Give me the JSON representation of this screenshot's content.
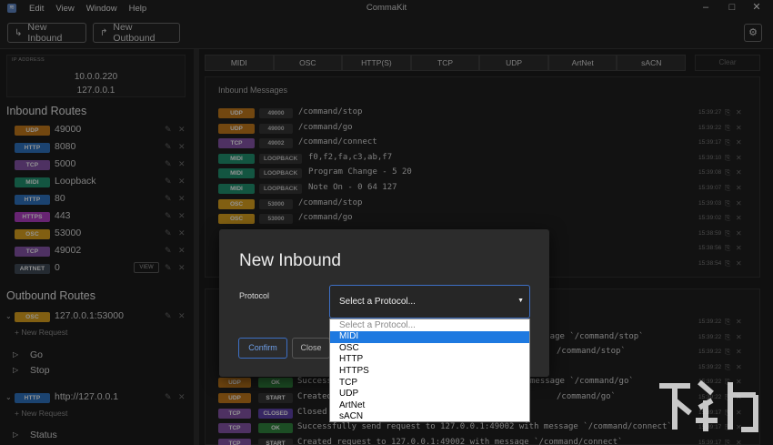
{
  "window": {
    "title": "CommaKit",
    "menu": [
      "Edit",
      "View",
      "Window",
      "Help"
    ]
  },
  "toolbar": {
    "new_inbound": "New Inbound",
    "new_outbound": "New Outbound"
  },
  "ip": {
    "label": "IP ADDRESS",
    "addresses": [
      "10.0.0.220",
      "127.0.0.1"
    ]
  },
  "inbound": {
    "title": "Inbound Routes",
    "routes": [
      {
        "protocol": "UDP",
        "value": "49000",
        "color": "#b8731a"
      },
      {
        "protocol": "HTTP",
        "value": "8080",
        "color": "#2d6db5"
      },
      {
        "protocol": "TCP",
        "value": "5000",
        "color": "#7e4f9e"
      },
      {
        "protocol": "MIDI",
        "value": "Loopback",
        "color": "#1f8a6a"
      },
      {
        "protocol": "HTTP",
        "value": "80",
        "color": "#2d6db5"
      },
      {
        "protocol": "HTTPS",
        "value": "443",
        "color": "#a63bb8"
      },
      {
        "protocol": "OSC",
        "value": "53000",
        "color": "#d19a1e"
      },
      {
        "protocol": "TCP",
        "value": "49002",
        "color": "#7e4f9e"
      },
      {
        "protocol": "ARTNET",
        "value": "0",
        "color": "#3d4652",
        "view": "VIEW"
      }
    ]
  },
  "outbound": {
    "title": "Outbound Routes",
    "route1": {
      "protocol": "OSC",
      "value": "127.0.0.1:53000",
      "color": "#d19a1e",
      "new_request": "New Request",
      "requests": [
        "Go",
        "Stop"
      ]
    },
    "route2": {
      "protocol": "HTTP",
      "value": "http://127.0.0.1",
      "color": "#2d6db5",
      "new_request": "New Request",
      "requests": [
        "Status"
      ]
    }
  },
  "tabs": [
    "MIDI",
    "OSC",
    "HTTP(S)",
    "TCP",
    "UDP",
    "ArtNet",
    "sACN"
  ],
  "clear": "Clear",
  "inbound_messages": {
    "title": "Inbound Messages",
    "rows": [
      {
        "p": "UDP",
        "c": "#b8731a",
        "port": "49000",
        "text": "/command/stop",
        "time": "15:39:27"
      },
      {
        "p": "UDP",
        "c": "#b8731a",
        "port": "49000",
        "text": "/command/go",
        "time": "15:39:22"
      },
      {
        "p": "TCP",
        "c": "#7e4f9e",
        "port": "49002",
        "text": "/command/connect",
        "time": "15:39:17"
      },
      {
        "p": "MIDI",
        "c": "#1f8a6a",
        "port": "LOOPBACK",
        "text": "f0,f2,fa,c3,ab,f7",
        "time": "15:39:10"
      },
      {
        "p": "MIDI",
        "c": "#1f8a6a",
        "port": "LOOPBACK",
        "text": "Program Change - 5 20",
        "time": "15:39:08"
      },
      {
        "p": "MIDI",
        "c": "#1f8a6a",
        "port": "LOOPBACK",
        "text": "Note On - 0 64 127",
        "time": "15:39:07"
      },
      {
        "p": "OSC",
        "c": "#d19a1e",
        "port": "53000",
        "text": "/command/stop",
        "time": "15:39:03"
      },
      {
        "p": "OSC",
        "c": "#d19a1e",
        "port": "53000",
        "text": "/command/go",
        "time": "15:39:02"
      },
      {
        "time": "15:38:59"
      },
      {
        "time": "15:38:56"
      },
      {
        "time": "15:38:54"
      }
    ]
  },
  "outbound_messages": {
    "rows": [
      {
        "time": "15:39:22"
      },
      {
        "time": "15:39:22",
        "tail": "message `/command/stop`"
      },
      {
        "time": "15:39:22",
        "tail": "/command/stop`"
      },
      {
        "time": "15:39:22"
      },
      {
        "time": "15:39:22",
        "p": "UDP",
        "c": "#b8731a",
        "status": "OK",
        "sc": "#2e7d3a",
        "text": "Success",
        "tail": "message `/command/go`"
      },
      {
        "time": "15:39:22",
        "p": "UDP",
        "c": "#b8731a",
        "status": "START",
        "sc": "#333333",
        "text": "Created",
        "tail": "/command/go`"
      },
      {
        "time": "15:39:17",
        "p": "TCP",
        "c": "#7e4f9e",
        "status": "CLOSED",
        "sc": "#5a3fa0",
        "text": "Closed"
      },
      {
        "time": "15:39:17",
        "p": "TCP",
        "c": "#7e4f9e",
        "status": "OK",
        "sc": "#2e7d3a",
        "text": "Successfully send request to 127.0.0.1:49002 with message `/command/connect`"
      },
      {
        "time": "15:39:17",
        "p": "TCP",
        "c": "#7e4f9e",
        "status": "START",
        "sc": "#333333",
        "text": "Created request to 127.0.0.1:49002 with message `/command/connect`"
      }
    ]
  },
  "modal": {
    "title": "New Inbound",
    "protocol_label": "Protocol",
    "select_text": "Select a Protocol...",
    "options": [
      "Select a Protocol...",
      "MIDI",
      "OSC",
      "HTTP",
      "HTTPS",
      "TCP",
      "UDP",
      "ArtNet",
      "sACN"
    ],
    "highlighted_option": "MIDI",
    "confirm": "Confirm",
    "close": "Close"
  }
}
